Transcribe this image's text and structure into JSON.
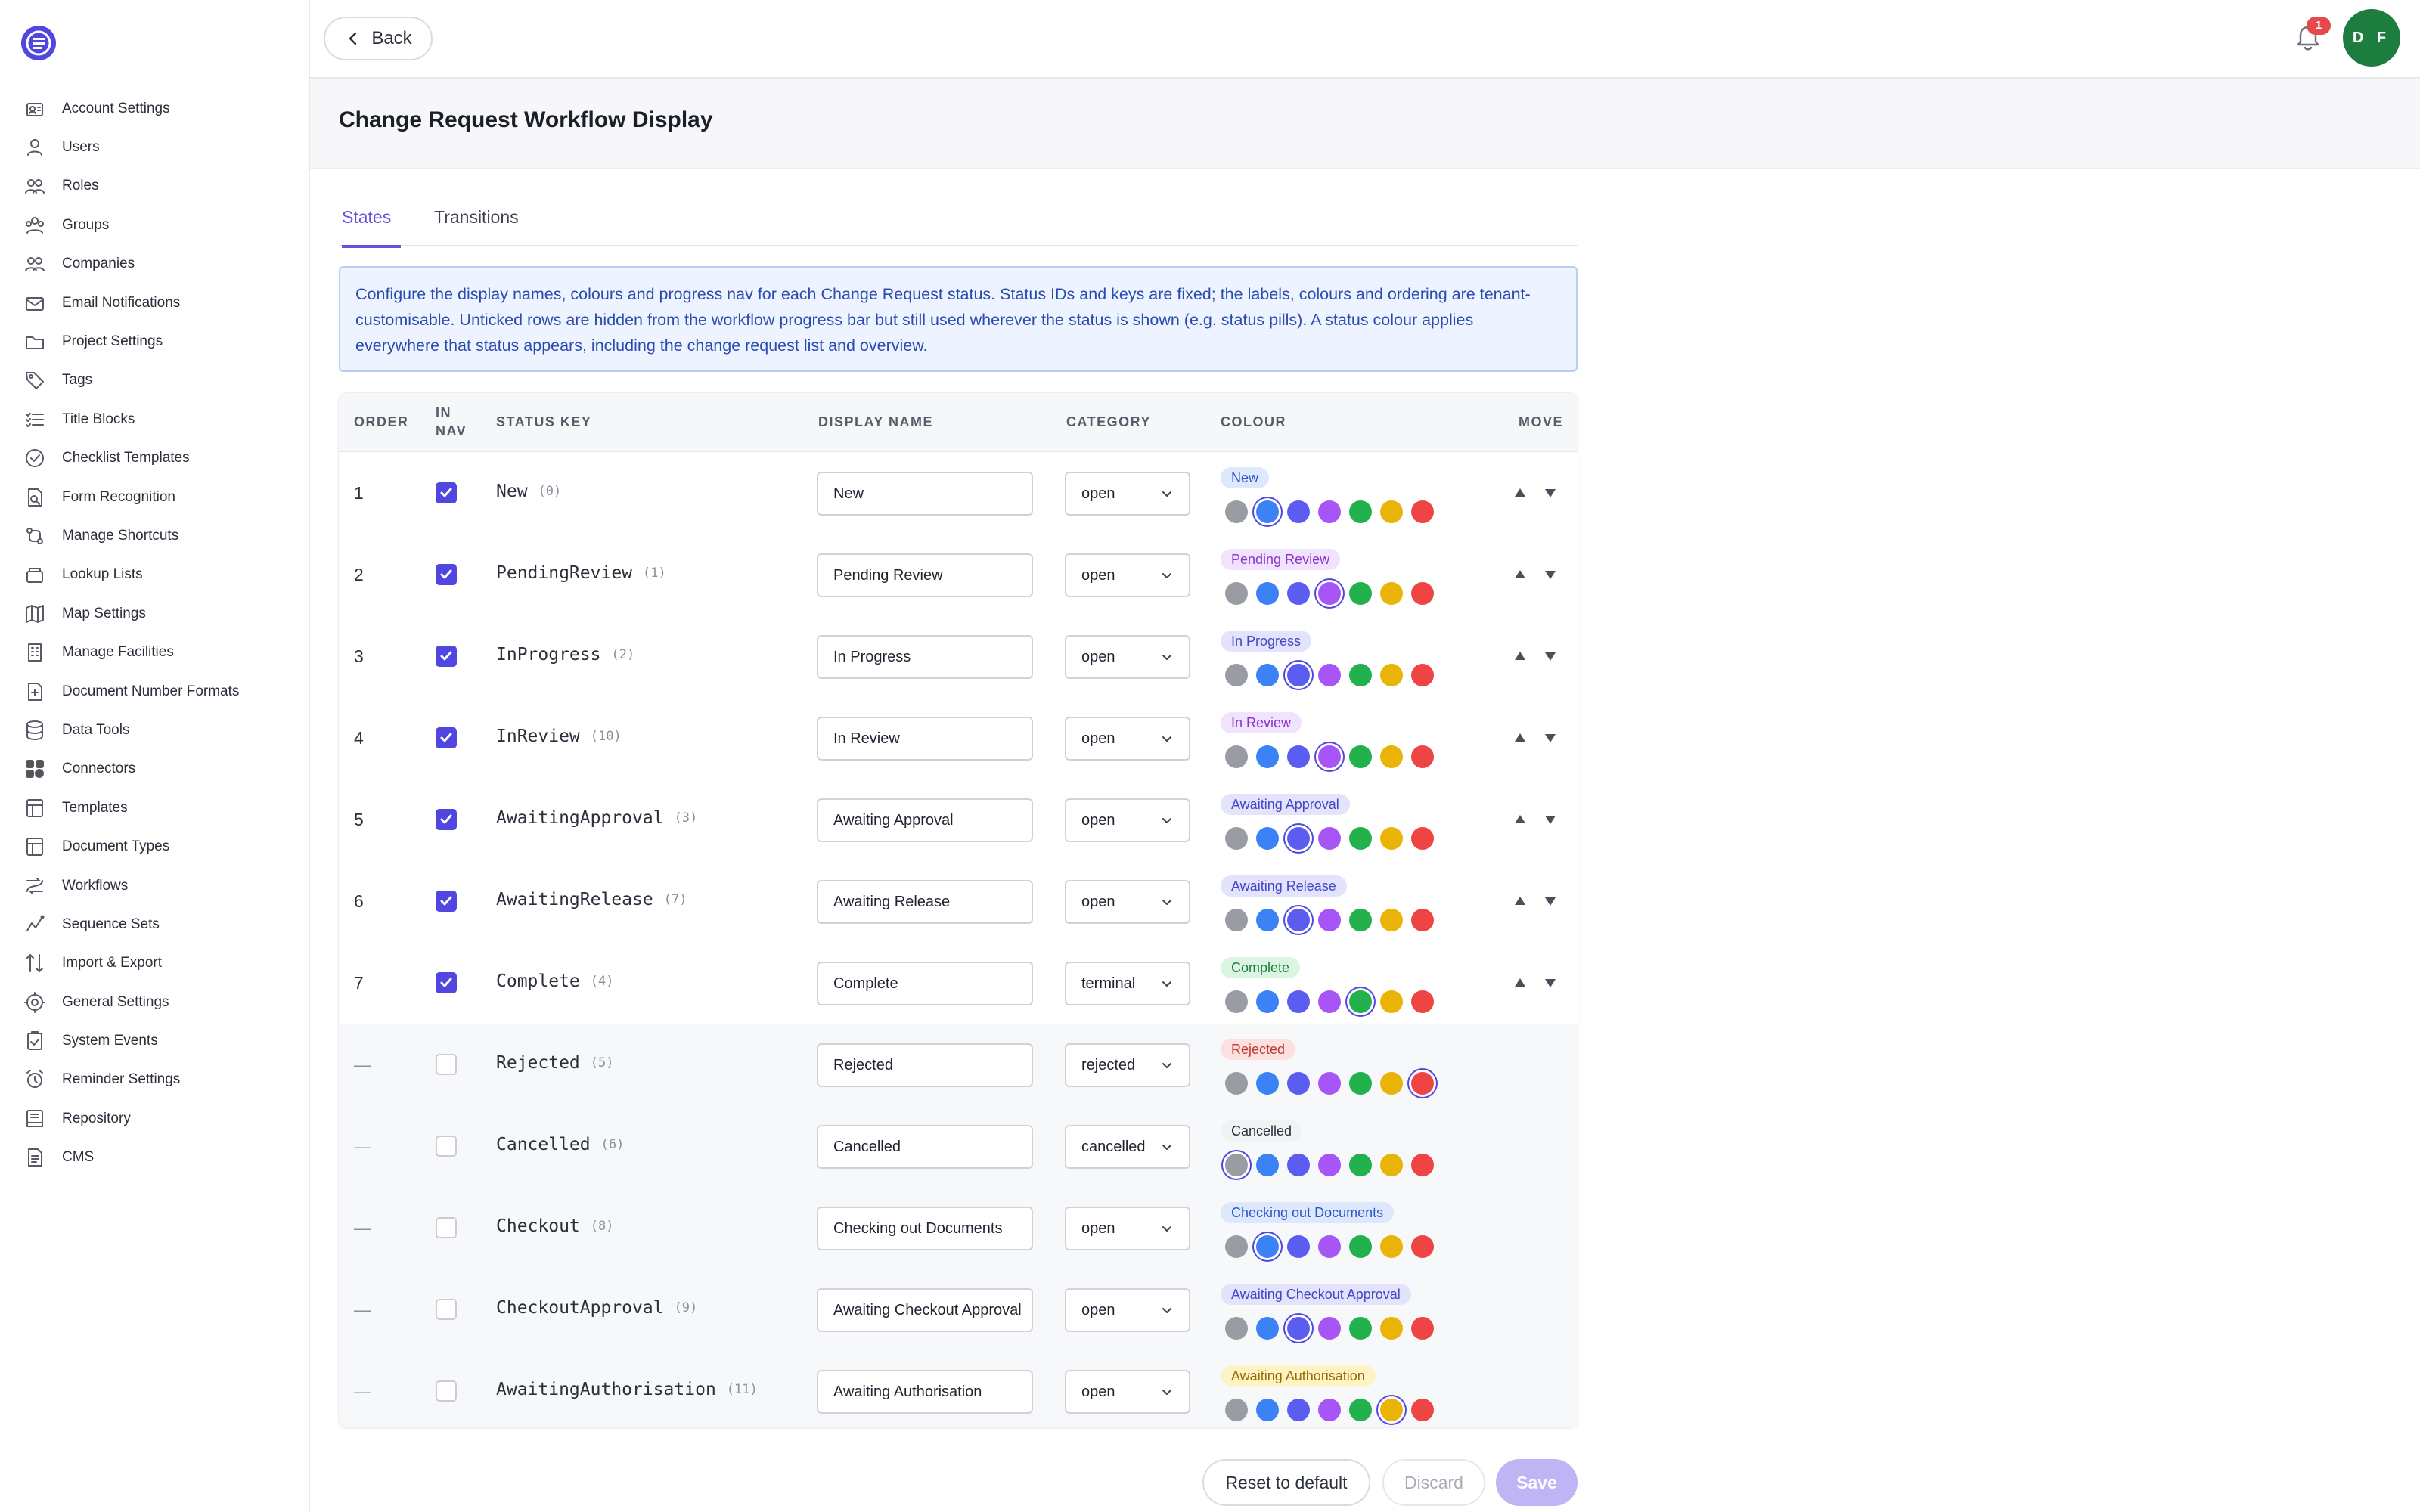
{
  "sidebar": {
    "items": [
      {
        "label": "Account Settings",
        "icon": "account-settings-icon"
      },
      {
        "label": "Users",
        "icon": "users-icon"
      },
      {
        "label": "Roles",
        "icon": "roles-icon"
      },
      {
        "label": "Groups",
        "icon": "groups-icon"
      },
      {
        "label": "Companies",
        "icon": "companies-icon"
      },
      {
        "label": "Email Notifications",
        "icon": "email-icon"
      },
      {
        "label": "Project Settings",
        "icon": "folder-icon"
      },
      {
        "label": "Tags",
        "icon": "tag-icon"
      },
      {
        "label": "Title Blocks",
        "icon": "list-check-icon"
      },
      {
        "label": "Checklist Templates",
        "icon": "check-circle-icon"
      },
      {
        "label": "Form Recognition",
        "icon": "form-search-icon"
      },
      {
        "label": "Manage Shortcuts",
        "icon": "shortcuts-icon"
      },
      {
        "label": "Lookup Lists",
        "icon": "lookup-icon"
      },
      {
        "label": "Map Settings",
        "icon": "map-icon"
      },
      {
        "label": "Manage Facilities",
        "icon": "building-icon"
      },
      {
        "label": "Document Number Formats",
        "icon": "doc-number-icon"
      },
      {
        "label": "Data Tools",
        "icon": "database-icon"
      },
      {
        "label": "Connectors",
        "icon": "connectors-icon"
      },
      {
        "label": "Templates",
        "icon": "template-icon"
      },
      {
        "label": "Document Types",
        "icon": "doc-types-icon"
      },
      {
        "label": "Workflows",
        "icon": "workflow-icon"
      },
      {
        "label": "Sequence Sets",
        "icon": "sequence-icon"
      },
      {
        "label": "Import & Export",
        "icon": "import-export-icon"
      },
      {
        "label": "General Settings",
        "icon": "gear-icon"
      },
      {
        "label": "System Events",
        "icon": "clipboard-check-icon"
      },
      {
        "label": "Reminder Settings",
        "icon": "alarm-icon"
      },
      {
        "label": "Repository",
        "icon": "repository-icon"
      },
      {
        "label": "CMS",
        "icon": "document-icon"
      }
    ]
  },
  "header": {
    "back_label": "Back",
    "notification_count": "1",
    "avatar_initials": "D F"
  },
  "page": {
    "title": "Change Request Workflow Display"
  },
  "tabs": [
    {
      "label": "States",
      "active": true
    },
    {
      "label": "Transitions",
      "active": false
    }
  ],
  "info_text": "Configure the display names, colours and progress nav for each Change Request status. Status IDs and keys are fixed; the labels, colours and ordering are tenant-customisable. Unticked rows are hidden from the workflow progress bar but still used wherever the status is shown (e.g. status pills). A status colour applies everywhere that status appears, including the change request list and overview.",
  "table": {
    "headers": {
      "order": "ORDER",
      "in_nav": "IN NAV",
      "status_key": "STATUS KEY",
      "display_name": "DISPLAY NAME",
      "category": "CATEGORY",
      "colour": "COLOUR",
      "move": "MOVE"
    },
    "palette": {
      "gray": "#9a9ca4",
      "blue": "#3b82f6",
      "indigo": "#5b5cf0",
      "purple": "#a855f7",
      "green": "#22b14c",
      "amber": "#eab308",
      "red": "#ef4444"
    },
    "palette_order": [
      "gray",
      "blue",
      "indigo",
      "purple",
      "green",
      "amber",
      "red"
    ],
    "pill_styles": {
      "gray": {
        "bg": "#f1f2f4",
        "fg": "#2a2f3a"
      },
      "blue": {
        "bg": "#dde8fd",
        "fg": "#2d56c9"
      },
      "indigo": {
        "bg": "#e3e3fb",
        "fg": "#4346c8"
      },
      "purple": {
        "bg": "#f1e3fd",
        "fg": "#8a35c9"
      },
      "green": {
        "bg": "#dcf5e3",
        "fg": "#1b7f3b"
      },
      "amber": {
        "bg": "#fdf3c4",
        "fg": "#9a6a00"
      },
      "red": {
        "bg": "#fde0e0",
        "fg": "#c0392b"
      }
    },
    "rows": [
      {
        "order": "1",
        "in_nav": true,
        "key": "New",
        "idx": "(0)",
        "display": "New",
        "category": "open",
        "colour": "blue",
        "movable": true
      },
      {
        "order": "2",
        "in_nav": true,
        "key": "PendingReview",
        "idx": "(1)",
        "display": "Pending Review",
        "category": "open",
        "colour": "purple",
        "movable": true
      },
      {
        "order": "3",
        "in_nav": true,
        "key": "InProgress",
        "idx": "(2)",
        "display": "In Progress",
        "category": "open",
        "colour": "indigo",
        "movable": true
      },
      {
        "order": "4",
        "in_nav": true,
        "key": "InReview",
        "idx": "(10)",
        "display": "In Review",
        "category": "open",
        "colour": "purple",
        "movable": true
      },
      {
        "order": "5",
        "in_nav": true,
        "key": "AwaitingApproval",
        "idx": "(3)",
        "display": "Awaiting Approval",
        "category": "open",
        "colour": "indigo",
        "movable": true
      },
      {
        "order": "6",
        "in_nav": true,
        "key": "AwaitingRelease",
        "idx": "(7)",
        "display": "Awaiting Release",
        "category": "open",
        "colour": "indigo",
        "movable": true
      },
      {
        "order": "7",
        "in_nav": true,
        "key": "Complete",
        "idx": "(4)",
        "display": "Complete",
        "category": "terminal",
        "colour": "green",
        "movable": true
      },
      {
        "order": "—",
        "in_nav": false,
        "key": "Rejected",
        "idx": "(5)",
        "display": "Rejected",
        "category": "rejected",
        "colour": "red",
        "movable": false
      },
      {
        "order": "—",
        "in_nav": false,
        "key": "Cancelled",
        "idx": "(6)",
        "display": "Cancelled",
        "category": "cancelled",
        "colour": "gray",
        "movable": false
      },
      {
        "order": "—",
        "in_nav": false,
        "key": "Checkout",
        "idx": "(8)",
        "display": "Checking out Documents",
        "category": "open",
        "colour": "blue",
        "movable": false
      },
      {
        "order": "—",
        "in_nav": false,
        "key": "CheckoutApproval",
        "idx": "(9)",
        "display": "Awaiting Checkout Approval",
        "category": "open",
        "colour": "indigo",
        "movable": false
      },
      {
        "order": "—",
        "in_nav": false,
        "key": "AwaitingAuthorisation",
        "idx": "(11)",
        "display": "Awaiting Authorisation",
        "category": "open",
        "colour": "amber",
        "movable": false
      }
    ]
  },
  "footer": {
    "reset_label": "Reset to default",
    "discard_label": "Discard",
    "save_label": "Save"
  }
}
